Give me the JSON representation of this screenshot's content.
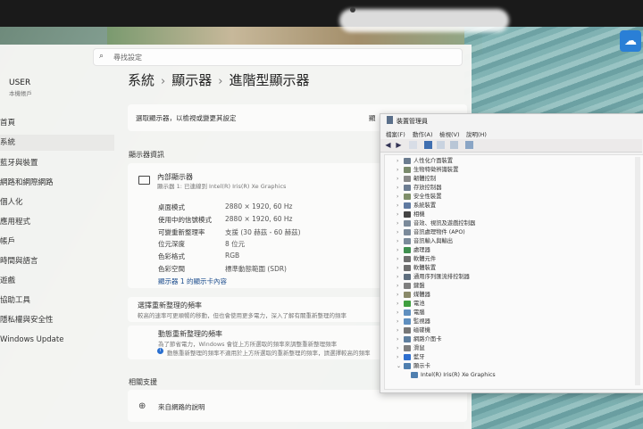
{
  "search": {
    "placeholder": "尋找設定"
  },
  "user": {
    "name": "USER",
    "sub": "本機帳戶"
  },
  "nav": [
    {
      "label": "首頁"
    },
    {
      "label": "系統"
    },
    {
      "label": "藍牙與裝置"
    },
    {
      "label": "網路和網際網路"
    },
    {
      "label": "個人化"
    },
    {
      "label": "應用程式"
    },
    {
      "label": "帳戶"
    },
    {
      "label": "時間與語言"
    },
    {
      "label": "遊戲"
    },
    {
      "label": "協助工具"
    },
    {
      "label": "隱私權與安全性"
    },
    {
      "label": "Windows Update"
    }
  ],
  "breadcrumb": {
    "a": "系統",
    "b": "顯示器",
    "c": "進階型顯示器"
  },
  "select_display": {
    "label": "選取顯示器，以檢視或變更其設定",
    "value": "顯"
  },
  "display_info": {
    "section": "顯示器資訊",
    "name": "內部顯示器",
    "sub": "顯示器 1: 已連線到 Intel(R) Iris(R) Xe Graphics",
    "rows": [
      {
        "k": "桌面模式",
        "v": "2880 × 1920, 60 Hz"
      },
      {
        "k": "使用中的信號模式",
        "v": "2880 × 1920, 60 Hz"
      },
      {
        "k": "可變重新整理率",
        "v": "支援 (30 赫茲 - 60 赫茲)"
      },
      {
        "k": "位元深度",
        "v": "8 位元"
      },
      {
        "k": "色彩格式",
        "v": "RGB"
      },
      {
        "k": "色彩空間",
        "v": "標準動態範圍 (SDR)"
      }
    ],
    "adapter_button": "顯示器 1 的顯示卡內容"
  },
  "refresh": {
    "title": "選擇重新整理的頻率",
    "sub": "較高的速率可更順暢的移動，但也會使用更多電力，深入了解有關重新整理的頻率",
    "dynamic_title": "動態重新整理的頻率",
    "dynamic_sub": "為了節省電力，Windows 會從上方所選取的頻率來調整重新整理頻率",
    "dynamic_note": "動態重新整理的頻率不適用於上方所選取的重新整理的頻率，請選擇較高的頻率"
  },
  "related": {
    "section": "相關支援",
    "help": "來自網路的說明"
  },
  "devmgr": {
    "title": "裝置管理員",
    "menu": [
      "檔案(F)",
      "動作(A)",
      "檢視(V)",
      "說明(H)"
    ],
    "items": [
      {
        "label": "人性化介面裝置",
        "color": "#6b7c8f"
      },
      {
        "label": "生物特徵辨識裝置",
        "color": "#7a8a6c"
      },
      {
        "label": "韌體控制",
        "color": "#8a8a8a"
      },
      {
        "label": "存放控制器",
        "color": "#6d7d92"
      },
      {
        "label": "安全性裝置",
        "color": "#7f8f6a"
      },
      {
        "label": "系統裝置",
        "color": "#5f7aa1"
      },
      {
        "label": "相機",
        "color": "#444444"
      },
      {
        "label": "音效、視訊及遊戲控制器",
        "color": "#7b8a9a"
      },
      {
        "label": "音訊處理物件 (APO)",
        "color": "#7b8a9a"
      },
      {
        "label": "音訊輸入與輸出",
        "color": "#7b8a9a"
      },
      {
        "label": "處理器",
        "color": "#3f8f4f"
      },
      {
        "label": "軟體元件",
        "color": "#6f6f6f"
      },
      {
        "label": "軟體裝置",
        "color": "#6f6f6f"
      },
      {
        "label": "通用序列匯流排控制器",
        "color": "#5f6f7f"
      },
      {
        "label": "鍵盤",
        "color": "#7f7f7f"
      },
      {
        "label": "媒體器",
        "color": "#8a8a6a"
      },
      {
        "label": "電池",
        "color": "#3f9f3f"
      },
      {
        "label": "電腦",
        "color": "#5f8fbf"
      },
      {
        "label": "監視器",
        "color": "#5f8fbf"
      },
      {
        "label": "磁碟機",
        "color": "#777777"
      },
      {
        "label": "網路介面卡",
        "color": "#5f7f9f"
      },
      {
        "label": "滑鼠",
        "color": "#7f7f7f"
      },
      {
        "label": "藍牙",
        "color": "#2f6fcf"
      },
      {
        "label": "顯示卡",
        "color": "#4f7faf"
      }
    ],
    "child": "Intel(R) Iris(R) Xe Graphics"
  }
}
